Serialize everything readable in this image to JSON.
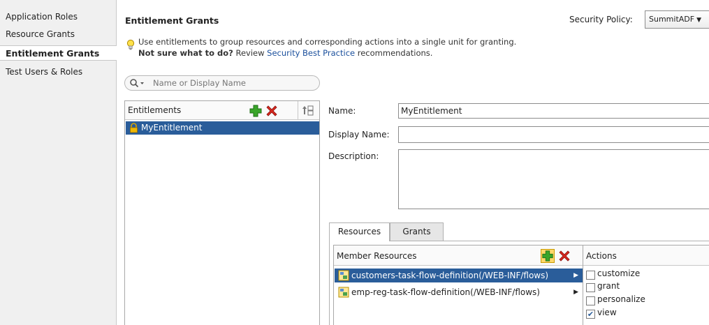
{
  "nav": {
    "items": [
      {
        "label": "Application Roles"
      },
      {
        "label": "Resource Grants"
      },
      {
        "label": "Entitlement Grants"
      },
      {
        "label": "Test Users & Roles"
      }
    ],
    "active": "Entitlement Grants"
  },
  "header": {
    "title": "Entitlement Grants",
    "security_policy_label": "Security Policy:",
    "security_policy_value": "SummitADF"
  },
  "hint": {
    "line1": "Use entitlements to group resources and corresponding actions into a single unit for granting.",
    "bold": "Not sure what to do?",
    "review": " Review ",
    "link": "Security Best Practice",
    "tail": " recommendations."
  },
  "search": {
    "placeholder": "Name or Display Name"
  },
  "entitlements": {
    "header": "Entitlements",
    "items": [
      "MyEntitlement"
    ],
    "selected": "MyEntitlement"
  },
  "form": {
    "name_label": "Name:",
    "name_value": "MyEntitlement",
    "display_name_label": "Display Name:",
    "display_name_value": "",
    "description_label": "Description:",
    "description_value": ""
  },
  "tabs": [
    {
      "label": "Resources",
      "active": true
    },
    {
      "label": "Grants",
      "active": false
    }
  ],
  "member_resources": {
    "header": "Member Resources",
    "items": [
      {
        "label": "customers-task-flow-definition(/WEB-INF/flows)",
        "selected": true
      },
      {
        "label": "emp-reg-task-flow-definition(/WEB-INF/flows)",
        "selected": false
      }
    ]
  },
  "actions": {
    "header": "Actions",
    "items": [
      {
        "label": "customize",
        "checked": false
      },
      {
        "label": "grant",
        "checked": false
      },
      {
        "label": "personalize",
        "checked": false
      },
      {
        "label": "view",
        "checked": true
      }
    ]
  },
  "colors": {
    "selection": "#2a5d9a",
    "link": "#1a4f9c",
    "add_green": "#3aa52a",
    "delete_red": "#d8281e"
  }
}
